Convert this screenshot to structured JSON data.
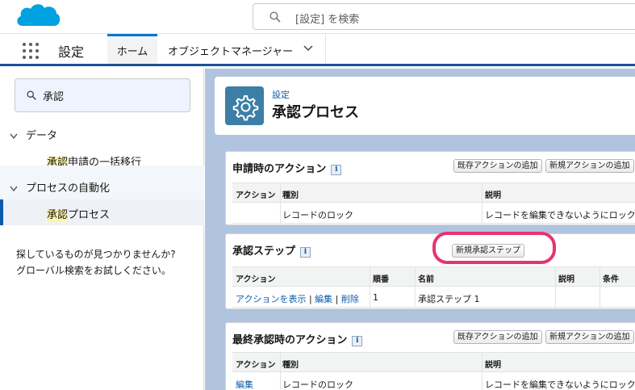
{
  "global_header": {
    "search_placeholder": "[設定] を検索",
    "logo_icon": "salesforce-cloud-icon",
    "brand_color": "#00a1e0"
  },
  "app_nav": {
    "app_name": "設定",
    "tabs": [
      {
        "label": "ホーム",
        "active": true
      },
      {
        "label": "オブジェクトマネージャー",
        "active": false
      }
    ]
  },
  "sidebar": {
    "quickfind_value": "承認",
    "categories": [
      {
        "label": "データ",
        "items": [
          {
            "highlight": "承認",
            "rest": "申請の一括移行",
            "selected": false
          }
        ]
      },
      {
        "label": "プロセスの自動化",
        "items": [
          {
            "highlight": "承認",
            "rest": "プロセス",
            "selected": true
          }
        ]
      }
    ],
    "not_found_line1": "探しているものが見つかりませんか?",
    "not_found_line2": "グローバル検索をお試しください。"
  },
  "page_header": {
    "eyebrow": "設定",
    "title": "承認プロセス",
    "icon": "gear-icon"
  },
  "initial_submission": {
    "title": "申請時のアクション",
    "btn_add_existing": "既存アクションの追加",
    "btn_add_new": "新規アクションの追加",
    "columns": [
      "アクション",
      "種別",
      "説明"
    ],
    "rows": [
      {
        "action": "",
        "type": "レコードのロック",
        "desc": "レコードを編集できないようにロック"
      }
    ]
  },
  "approval_steps": {
    "title": "承認ステップ",
    "btn_new_step": "新規承認ステップ",
    "columns": [
      "アクション",
      "順番",
      "名前",
      "説明",
      "条件"
    ],
    "rows": [
      {
        "show_actions": "アクションを表示",
        "edit": "編集",
        "delete": "削除",
        "sep": "|",
        "order": "1",
        "name": "承認ステップ 1",
        "desc": "",
        "condition": ""
      }
    ]
  },
  "final_approval": {
    "title": "最終承認時のアクション",
    "btn_add_existing": "既存アクションの追加",
    "btn_add_new": "新規アクションの追加",
    "columns": [
      "アクション",
      "種別",
      "説明"
    ],
    "rows": [
      {
        "action": "編集",
        "type": "レコードのロック",
        "desc": "レコードを編集できないようにロック"
      }
    ]
  },
  "annotation": {
    "color": "#e8336e",
    "target": "新規承認ステップ"
  }
}
